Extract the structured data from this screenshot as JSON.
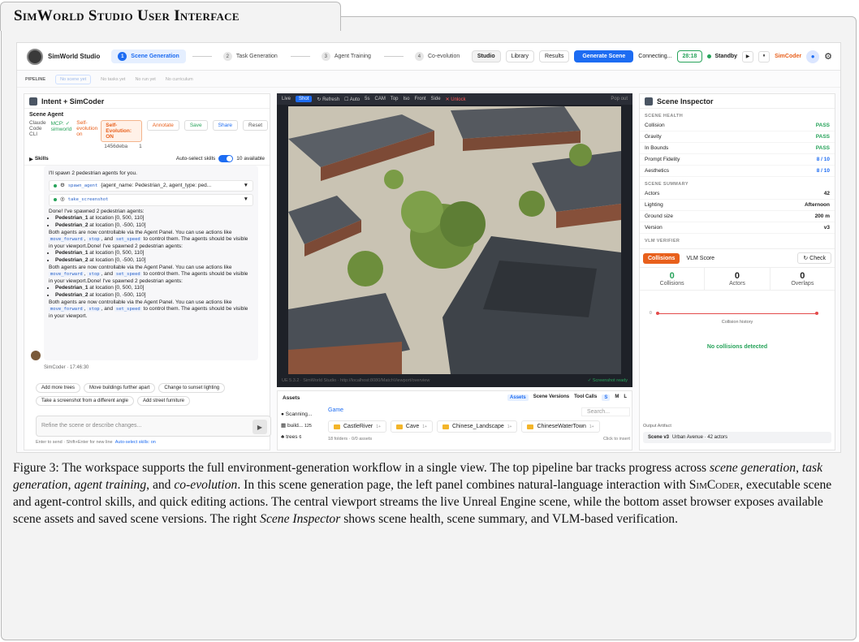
{
  "figure_title": "SimWorld Studio User Interface",
  "app": {
    "brand": "SimWorld Studio",
    "steps": [
      {
        "num": "1",
        "label": "Scene Generation"
      },
      {
        "num": "2",
        "label": "Task Generation"
      },
      {
        "num": "3",
        "label": "Agent Training"
      },
      {
        "num": "4",
        "label": "Co-evolution"
      }
    ],
    "view_tabs": [
      "Studio",
      "Library",
      "Results"
    ],
    "generate_label": "Generate Scene",
    "connecting": "Connecting...",
    "timer": "28:18",
    "standby": "Standby",
    "play_icon": "▶",
    "pause_icon": "⏸",
    "user": "SimCoder"
  },
  "pipeline": {
    "label": "PIPELINE",
    "items": [
      "No scene yet",
      "No tasks yet",
      "No run yet",
      "No curriculum"
    ]
  },
  "left": {
    "title": "Intent + SimCoder",
    "agent_title": "Scene Agent",
    "agent_name": "Claude Code CLI",
    "mcp": "MCP: ✓ simworld",
    "self_evo": "Self-evolution on",
    "evo_toggle": "Self-Evolution: ON",
    "hash": "1456deba",
    "count": "1",
    "annotate": "Annotate",
    "save": "Save",
    "share": "Share",
    "reset": "Reset",
    "skills_label": "Skills",
    "auto_select": "Auto-select skills",
    "available": "10 available",
    "chat": {
      "intro": "I'll spawn 2 pedestrian agents for you.",
      "tool1_name": "spawn_agent",
      "tool1_args": "{agent_name: Pedestrian_2, agent_type: ped...",
      "tool2_name": "take_screenshot",
      "done": "Done! I've spawned 2 pedestrian agents:",
      "p1_name": "Pedestrian_1",
      "p1_loc": " at location [0, 500, 110]",
      "p2_name": "Pedestrian_2",
      "p2_loc": " at location [0, -500, 110]",
      "both_a": "Both agents are now controllable via the Agent Panel. You can use actions like ",
      "c1": "move_forward",
      "c2": "stop",
      "c3": "set_speed",
      "both_b": " to control them. The agents should be visible in your viewport.",
      "repeat_tail": "Done! I've spawned 2 pedestrian agents:"
    },
    "sender": "SimCoder · 17:46:30",
    "suggestions": [
      "Add more trees",
      "Move buildings further apart",
      "Change to sunset lighting",
      "Take a screenshot from a different angle",
      "Add street furniture"
    ],
    "input_placeholder": "Refine the scene or describe changes...",
    "hint_text": "Enter to send · Shift+Enter for new line",
    "hint_link": "Auto-select skills: on"
  },
  "viewport": {
    "tabs": [
      "Live",
      "Shot",
      "Refresh",
      "Auto",
      "5s",
      "CAM",
      "Top",
      "Iso",
      "Front",
      "Side",
      "Unlock"
    ],
    "popout": "Pop out",
    "footer_left": "UE 5.3.2 · SimWorld Studio · http://localhost:8080/MatchViewport/overview",
    "footer_right": "✓ Screenshot ready"
  },
  "assets": {
    "title": "Assets",
    "tabs": [
      "Assets",
      "Scene Versions",
      "Tool Calls",
      "S",
      "M",
      "L"
    ],
    "side": [
      "Scanning...",
      "build...",
      "125",
      "trees",
      "6"
    ],
    "path": "Game",
    "search": "Search...",
    "folders": [
      {
        "name": "CastleRiver",
        "count": "1+"
      },
      {
        "name": "Cave",
        "count": "1+"
      },
      {
        "name": "Chinese_Landscape",
        "count": "1+"
      },
      {
        "name": "ChineseWaterTown",
        "count": "1+"
      }
    ],
    "foot_left": "18 folders · 0/0 assets",
    "foot_right": "Click to insert"
  },
  "inspector": {
    "title": "Scene Inspector",
    "health_label": "SCENE HEALTH",
    "health": [
      {
        "k": "Collision",
        "v": "PASS"
      },
      {
        "k": "Gravity",
        "v": "PASS"
      },
      {
        "k": "In Bounds",
        "v": "PASS"
      },
      {
        "k": "Prompt Fidelity",
        "v": "8 / 10"
      },
      {
        "k": "Aesthetics",
        "v": "8 / 10"
      }
    ],
    "summary_label": "SCENE SUMMARY",
    "summary": [
      {
        "k": "Actors",
        "v": "42"
      },
      {
        "k": "Lighting",
        "v": "Afternoon"
      },
      {
        "k": "Ground size",
        "v": "200 m"
      },
      {
        "k": "Version",
        "v": "v3"
      }
    ],
    "vlm_label": "VLM VERIFIER",
    "vlm_tab_on": "Collisions",
    "vlm_tab_off": "VLM Score",
    "check": "↻ Check",
    "stats": [
      {
        "n": "0",
        "l": "Collisions"
      },
      {
        "n": "0",
        "l": "Actors"
      },
      {
        "n": "0",
        "l": "Overlaps"
      }
    ],
    "hist_zero": "0",
    "hist_caption": "Collision history",
    "no_collisions": "No collisions detected",
    "artifact_label": "Output Artifact",
    "artifact_version": "Scene v3",
    "artifact_desc": "Urban Avenue · 42 actors"
  },
  "caption": {
    "p1": "Figure 3: The workspace supports the full environment-generation workflow in a single view. The top pipeline bar tracks progress across ",
    "i1": "scene generation",
    "s1": ", ",
    "i2": "task generation",
    "s2": ", ",
    "i3": "agent training",
    "s3": ", and ",
    "i4": "co-evolution",
    "p2": ". In this scene generation page, the left panel combines natural-language interaction with ",
    "simcoder": "SimCoder",
    "p3": ", executable scene and agent-control skills, and quick editing actions. The central viewport streams the live Unreal Engine scene, while the bottom asset browser exposes available scene assets and saved scene versions. The right ",
    "i5": "Scene Inspector",
    "p4": " shows scene health, scene summary, and VLM-based verification."
  }
}
